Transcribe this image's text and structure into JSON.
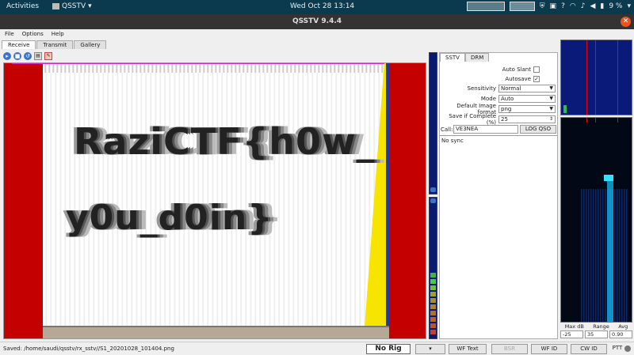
{
  "topbar": {
    "activities": "Activities",
    "app_name": "QSSTV",
    "clock": "Wed Oct 28  13:14",
    "battery": "9 %"
  },
  "window": {
    "title": "QSSTV 9.4.4"
  },
  "menu": [
    "File",
    "Options",
    "Help"
  ],
  "tabs": [
    "Receive",
    "Transmit",
    "Gallery"
  ],
  "image_text": {
    "line1": "RaziCTF{h0w_",
    "line2": "y0u_d0in}"
  },
  "panel": {
    "tabs": [
      "SSTV",
      "DRM"
    ],
    "auto_slant_label": "Auto Slant",
    "autosave_label": "Autosave",
    "autosave_checked": "✓",
    "sensitivity_label": "Sensitivity",
    "sensitivity_value": "Normal",
    "mode_label": "Mode",
    "mode_value": "Auto",
    "format_label": "Default Image format",
    "format_value": "png",
    "save_complete_label": "Save if Complete (%)",
    "save_complete_value": "25",
    "call_label": "Call:",
    "call_value": "VE3NEA",
    "log_button": "LOG QSO",
    "log_text": "No sync"
  },
  "waterfall_controls": {
    "max_db_label": "Max dB",
    "range_label": "Range",
    "avg_label": "Avg",
    "max_db_value": "-25",
    "range_value": "35",
    "avg_value": "0.90"
  },
  "statusbar": {
    "saved_text": "Saved: /home/saudi/qsstv/rx_sstv//S1_20201028_101404.png",
    "rig": "No Rig",
    "wf_text": "WF Text",
    "bsr": "BSR",
    "wf_id": "WF ID",
    "cw_id": "CW ID",
    "ptt": "PTT"
  },
  "colors": {
    "accent": "#3b73c8",
    "image_red": "#c40000",
    "close_button": "#e95420"
  }
}
